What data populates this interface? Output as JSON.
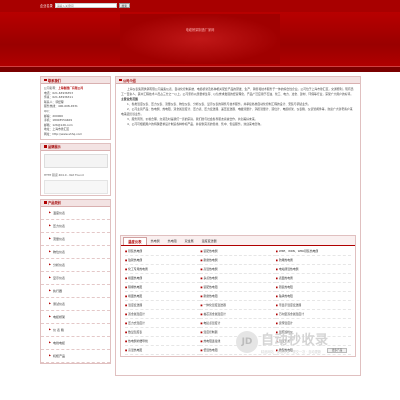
{
  "header": {
    "search_label": "企业名录",
    "search_placeholder": "请输入关键词",
    "search_button": "搜索",
    "banner_title": "电缆桥架制造厂家网"
  },
  "colors": {
    "brand_red": "#b00000",
    "dark_red": "#7a0000",
    "panel_tint": "#f3e3e3"
  },
  "contact": {
    "heading": "联系我们",
    "lines": [
      {
        "label": "公司名称：",
        "value": "上海衡器厂有限公司",
        "highlight": true
      },
      {
        "label": "电话：",
        "value": "021-63936353"
      },
      {
        "label": "传真：",
        "value": "021-63936311"
      },
      {
        "label": "联系人：",
        "value": "郭经理"
      },
      {
        "label": "服务热线：",
        "value": "400-008-4531"
      },
      {
        "label": "QQ：",
        "value": ""
      },
      {
        "label": "邮编：",
        "value": "200000"
      },
      {
        "label": "手机：",
        "value": "18903554469"
      },
      {
        "label": "邮箱：",
        "value": "126@126.com"
      },
      {
        "label": "地址：",
        "value": "上海市徐汇区"
      },
      {
        "label": "网址：",
        "value": "http://www.shhq.com"
      }
    ]
  },
  "ad": {
    "heading": "品牌展示",
    "error_text": "HTTP 错误 404.0 - Not Found"
  },
  "categories": {
    "heading": "产品类别",
    "items": [
      "温度仪表",
      "压力仪表",
      "流量仪表",
      "物位仪表",
      "分析仪表",
      "显示仪表",
      "执行器",
      "测试仪表",
      "电缆桥架",
      "仪 表 箱",
      "电线电缆",
      "机柜产品"
    ]
  },
  "about": {
    "heading": "公司介绍",
    "paragraphs": [
      "上海仪表集团供销有限公司是集仪表、自动化控制系统、电缆桥架及各种相关配套产品的研发、生产、销售和技术服务于一体的综合性企业。公司位于上海市徐汇区，交通便利，现有员工一百余人，其中工程技术人员占三分之一以上。公司坚持以质量求生存、以信誉求发展的经营理念，产品广泛应用于石油、化工、电力、冶金、建材、环保等行业，深受广大用户的好评。",
      "主营业务范围",
      "1、各类温度仪表、压力仪表、流量仪表、物位仪表、分析仪表、显示仪表的销售与技术服务，并承接各类自动化控制工程的设计、安装与调试业务。",
      "2、公司主营产品：热电偶、热电阻、双金属温度计、压力表、压力变送器、差压变送器、电磁流量计、涡街流量计、液位计、电缆桥架、仪表箱、仪表管阀件等，欢迎广大新老客户来电来函洽谈业务。",
      "3、服务周到、价格合理、交货及时是我们一贯的宗旨，我们愿与社会各界朋友真诚合作，共创美好未来。",
      "4、公司可根据用户的特殊要求设计制造各种非标产品，并提供完善的售前、售中、售后服务，欢迎来电咨询。"
    ]
  },
  "products": {
    "tabs": [
      "温度仪表",
      "热电偶",
      "热电阻",
      "双金属",
      "温度变送器"
    ],
    "active_tab": 0,
    "items": [
      "铠装热电偶",
      "装配热电偶",
      "WRE、WRN、WRK铠装热电偶",
      "铂铑热电偶",
      "耐磨热电偶",
      "防爆热电偶",
      "化工专用热电偶",
      "高温热电偶",
      "电站测温热电偶",
      "端面热电偶",
      "多点热电偶",
      "表面热电偶",
      "隔爆热电阻",
      "装配热电阻",
      "铠装热电阻",
      "端面热电阻",
      "耐磨热电阻",
      "轴承热电阻",
      "温度变送器",
      "一体化温度变送器",
      "带显示温度变送器",
      "双金属温度计",
      "抽芯双金属温度计",
      "万向型双金属温度计",
      "压力式温度计",
      "电接点温度计",
      "远传温度计",
      "数显温度表",
      "温度控制器",
      "温度巡检仪",
      "热电偶补偿导线",
      "热电阻连接线",
      "温度开关",
      "高温热电阻",
      "低温热电阻",
      "微型热电阻"
    ],
    "more_button": "更多产品"
  },
  "watermark": {
    "logo_text": "JD",
    "main": "自动秒收录",
    "sub": "精品网站 · 免费收录 · 提交一次 · 自动更新"
  }
}
